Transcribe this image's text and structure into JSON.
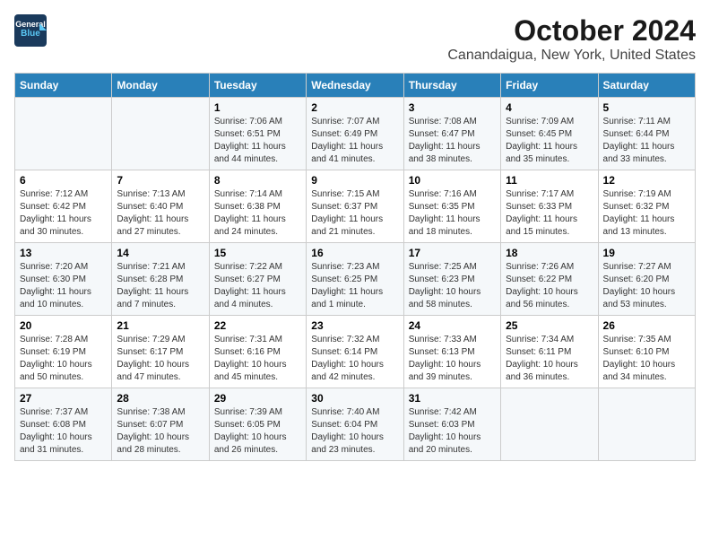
{
  "logo": {
    "line1": "General",
    "line2": "Blue"
  },
  "title": "October 2024",
  "location": "Canandaigua, New York, United States",
  "days_of_week": [
    "Sunday",
    "Monday",
    "Tuesday",
    "Wednesday",
    "Thursday",
    "Friday",
    "Saturday"
  ],
  "weeks": [
    [
      {
        "day": "",
        "sunrise": "",
        "sunset": "",
        "daylight": ""
      },
      {
        "day": "",
        "sunrise": "",
        "sunset": "",
        "daylight": ""
      },
      {
        "day": "1",
        "sunrise": "Sunrise: 7:06 AM",
        "sunset": "Sunset: 6:51 PM",
        "daylight": "Daylight: 11 hours and 44 minutes."
      },
      {
        "day": "2",
        "sunrise": "Sunrise: 7:07 AM",
        "sunset": "Sunset: 6:49 PM",
        "daylight": "Daylight: 11 hours and 41 minutes."
      },
      {
        "day": "3",
        "sunrise": "Sunrise: 7:08 AM",
        "sunset": "Sunset: 6:47 PM",
        "daylight": "Daylight: 11 hours and 38 minutes."
      },
      {
        "day": "4",
        "sunrise": "Sunrise: 7:09 AM",
        "sunset": "Sunset: 6:45 PM",
        "daylight": "Daylight: 11 hours and 35 minutes."
      },
      {
        "day": "5",
        "sunrise": "Sunrise: 7:11 AM",
        "sunset": "Sunset: 6:44 PM",
        "daylight": "Daylight: 11 hours and 33 minutes."
      }
    ],
    [
      {
        "day": "6",
        "sunrise": "Sunrise: 7:12 AM",
        "sunset": "Sunset: 6:42 PM",
        "daylight": "Daylight: 11 hours and 30 minutes."
      },
      {
        "day": "7",
        "sunrise": "Sunrise: 7:13 AM",
        "sunset": "Sunset: 6:40 PM",
        "daylight": "Daylight: 11 hours and 27 minutes."
      },
      {
        "day": "8",
        "sunrise": "Sunrise: 7:14 AM",
        "sunset": "Sunset: 6:38 PM",
        "daylight": "Daylight: 11 hours and 24 minutes."
      },
      {
        "day": "9",
        "sunrise": "Sunrise: 7:15 AM",
        "sunset": "Sunset: 6:37 PM",
        "daylight": "Daylight: 11 hours and 21 minutes."
      },
      {
        "day": "10",
        "sunrise": "Sunrise: 7:16 AM",
        "sunset": "Sunset: 6:35 PM",
        "daylight": "Daylight: 11 hours and 18 minutes."
      },
      {
        "day": "11",
        "sunrise": "Sunrise: 7:17 AM",
        "sunset": "Sunset: 6:33 PM",
        "daylight": "Daylight: 11 hours and 15 minutes."
      },
      {
        "day": "12",
        "sunrise": "Sunrise: 7:19 AM",
        "sunset": "Sunset: 6:32 PM",
        "daylight": "Daylight: 11 hours and 13 minutes."
      }
    ],
    [
      {
        "day": "13",
        "sunrise": "Sunrise: 7:20 AM",
        "sunset": "Sunset: 6:30 PM",
        "daylight": "Daylight: 11 hours and 10 minutes."
      },
      {
        "day": "14",
        "sunrise": "Sunrise: 7:21 AM",
        "sunset": "Sunset: 6:28 PM",
        "daylight": "Daylight: 11 hours and 7 minutes."
      },
      {
        "day": "15",
        "sunrise": "Sunrise: 7:22 AM",
        "sunset": "Sunset: 6:27 PM",
        "daylight": "Daylight: 11 hours and 4 minutes."
      },
      {
        "day": "16",
        "sunrise": "Sunrise: 7:23 AM",
        "sunset": "Sunset: 6:25 PM",
        "daylight": "Daylight: 11 hours and 1 minute."
      },
      {
        "day": "17",
        "sunrise": "Sunrise: 7:25 AM",
        "sunset": "Sunset: 6:23 PM",
        "daylight": "Daylight: 10 hours and 58 minutes."
      },
      {
        "day": "18",
        "sunrise": "Sunrise: 7:26 AM",
        "sunset": "Sunset: 6:22 PM",
        "daylight": "Daylight: 10 hours and 56 minutes."
      },
      {
        "day": "19",
        "sunrise": "Sunrise: 7:27 AM",
        "sunset": "Sunset: 6:20 PM",
        "daylight": "Daylight: 10 hours and 53 minutes."
      }
    ],
    [
      {
        "day": "20",
        "sunrise": "Sunrise: 7:28 AM",
        "sunset": "Sunset: 6:19 PM",
        "daylight": "Daylight: 10 hours and 50 minutes."
      },
      {
        "day": "21",
        "sunrise": "Sunrise: 7:29 AM",
        "sunset": "Sunset: 6:17 PM",
        "daylight": "Daylight: 10 hours and 47 minutes."
      },
      {
        "day": "22",
        "sunrise": "Sunrise: 7:31 AM",
        "sunset": "Sunset: 6:16 PM",
        "daylight": "Daylight: 10 hours and 45 minutes."
      },
      {
        "day": "23",
        "sunrise": "Sunrise: 7:32 AM",
        "sunset": "Sunset: 6:14 PM",
        "daylight": "Daylight: 10 hours and 42 minutes."
      },
      {
        "day": "24",
        "sunrise": "Sunrise: 7:33 AM",
        "sunset": "Sunset: 6:13 PM",
        "daylight": "Daylight: 10 hours and 39 minutes."
      },
      {
        "day": "25",
        "sunrise": "Sunrise: 7:34 AM",
        "sunset": "Sunset: 6:11 PM",
        "daylight": "Daylight: 10 hours and 36 minutes."
      },
      {
        "day": "26",
        "sunrise": "Sunrise: 7:35 AM",
        "sunset": "Sunset: 6:10 PM",
        "daylight": "Daylight: 10 hours and 34 minutes."
      }
    ],
    [
      {
        "day": "27",
        "sunrise": "Sunrise: 7:37 AM",
        "sunset": "Sunset: 6:08 PM",
        "daylight": "Daylight: 10 hours and 31 minutes."
      },
      {
        "day": "28",
        "sunrise": "Sunrise: 7:38 AM",
        "sunset": "Sunset: 6:07 PM",
        "daylight": "Daylight: 10 hours and 28 minutes."
      },
      {
        "day": "29",
        "sunrise": "Sunrise: 7:39 AM",
        "sunset": "Sunset: 6:05 PM",
        "daylight": "Daylight: 10 hours and 26 minutes."
      },
      {
        "day": "30",
        "sunrise": "Sunrise: 7:40 AM",
        "sunset": "Sunset: 6:04 PM",
        "daylight": "Daylight: 10 hours and 23 minutes."
      },
      {
        "day": "31",
        "sunrise": "Sunrise: 7:42 AM",
        "sunset": "Sunset: 6:03 PM",
        "daylight": "Daylight: 10 hours and 20 minutes."
      },
      {
        "day": "",
        "sunrise": "",
        "sunset": "",
        "daylight": ""
      },
      {
        "day": "",
        "sunrise": "",
        "sunset": "",
        "daylight": ""
      }
    ]
  ]
}
